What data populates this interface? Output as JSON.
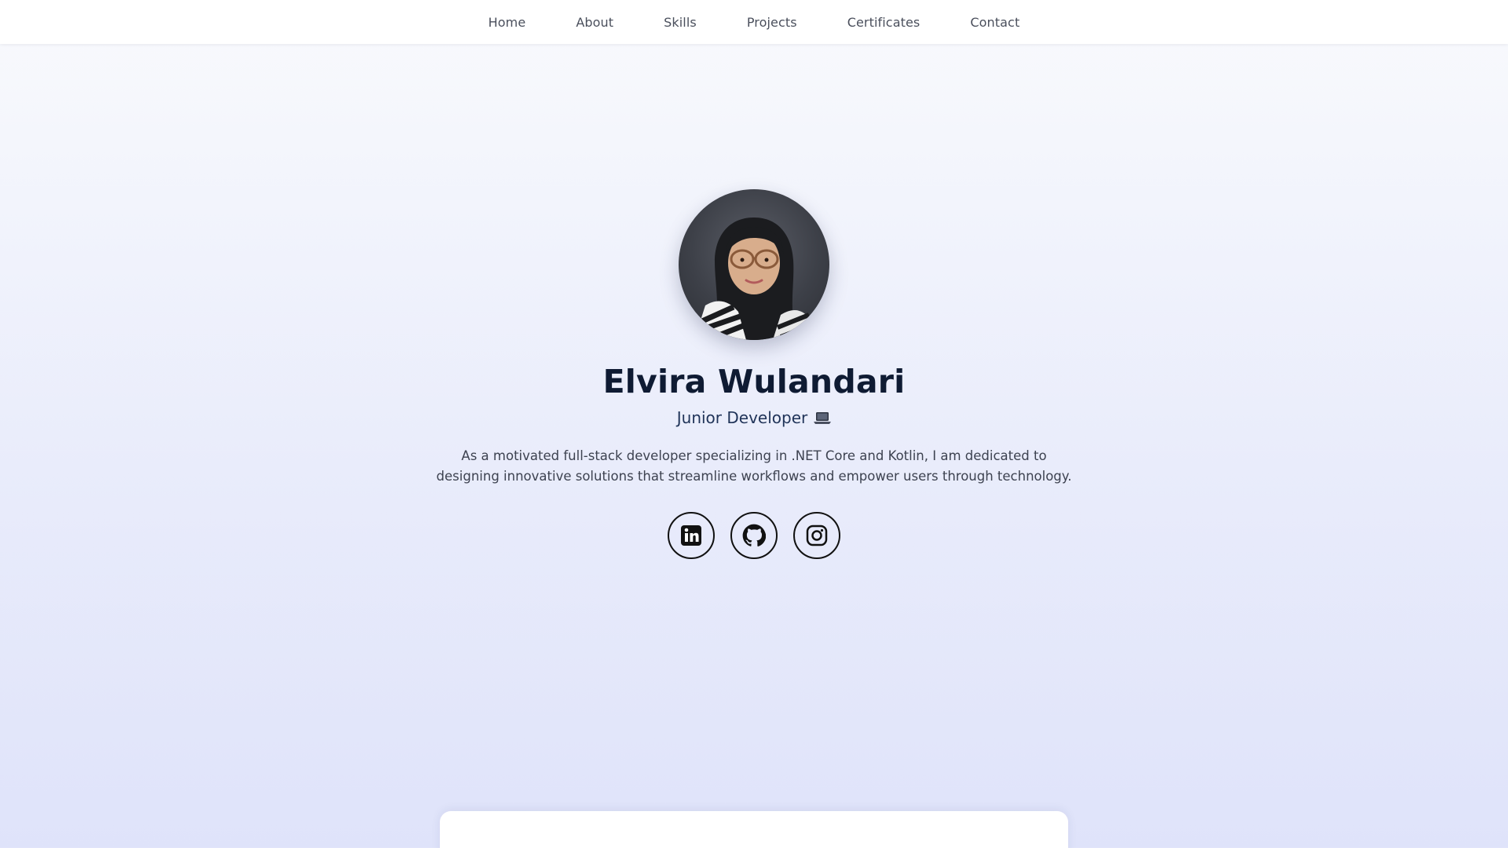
{
  "nav": {
    "items": [
      {
        "label": "Home"
      },
      {
        "label": "About"
      },
      {
        "label": "Skills"
      },
      {
        "label": "Projects"
      },
      {
        "label": "Certificates"
      },
      {
        "label": "Contact"
      }
    ]
  },
  "hero": {
    "avatar_icon": "profile-photo",
    "name": "Elvira Wulandari",
    "role": "Junior Developer",
    "role_icon": "laptop-icon",
    "bio": "As a motivated full-stack developer specializing in .NET Core and Kotlin, I am dedicated to designing innovative solutions that streamline workflows and empower users through technology."
  },
  "socials": [
    {
      "icon": "linkedin-icon"
    },
    {
      "icon": "github-icon"
    },
    {
      "icon": "instagram-icon"
    }
  ],
  "colors": {
    "heading": "#0f1b33",
    "role": "#1f3358",
    "body_text": "#3d4250",
    "nav_text": "#4a4f5c",
    "bg_top": "#f9fafd",
    "bg_bottom": "#dfe3fa"
  }
}
